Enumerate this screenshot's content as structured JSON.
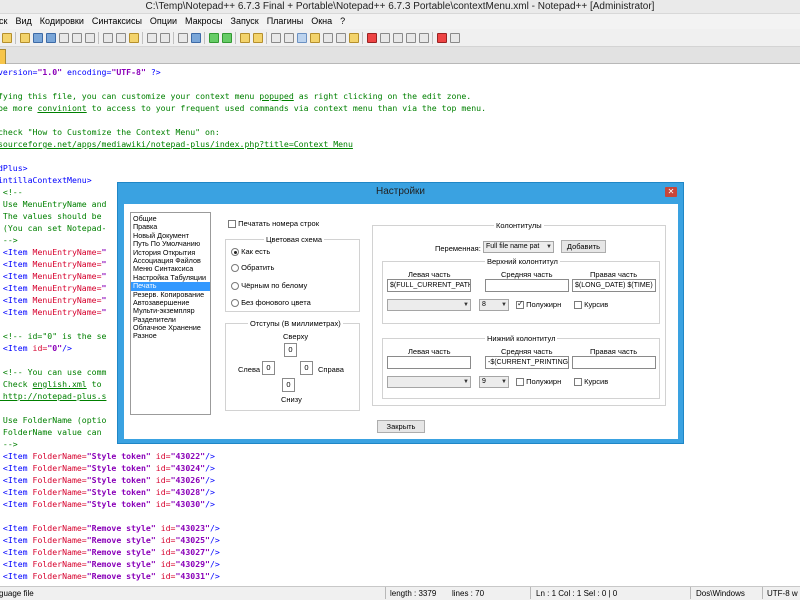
{
  "window": {
    "title": "C:\\Temp\\Notepad++ 6.7.3 Final + Portable\\Notepad++ 6.7.3 Portable\\contextMenu.xml - Notepad++ [Administrator]"
  },
  "menu": [
    "иск",
    "Вид",
    "Кодировки",
    "Синтаксисы",
    "Опции",
    "Макросы",
    "Запуск",
    "Плагины",
    "Окна",
    "?"
  ],
  "editor": {
    "lines": [
      {
        "parts": [
          {
            "c": "k",
            "t": "version="
          },
          {
            "c": "s",
            "t": "\"1.0\""
          },
          {
            "c": "k",
            "t": " encoding="
          },
          {
            "c": "s",
            "t": "\"UTF-8\""
          },
          {
            "c": "k",
            "t": " ?>"
          }
        ]
      },
      {
        "parts": []
      },
      {
        "parts": [
          {
            "c": "c",
            "t": "fying this file, you can customize your context menu "
          },
          {
            "c": "u",
            "t": "popuped"
          },
          {
            "c": "c",
            "t": " as right clicking on the edit zone."
          }
        ]
      },
      {
        "parts": [
          {
            "c": "c",
            "t": "be more "
          },
          {
            "c": "u",
            "t": "conviniont"
          },
          {
            "c": "c",
            "t": " to access to your frequent used commands via context menu than via the top menu."
          }
        ]
      },
      {
        "parts": []
      },
      {
        "parts": [
          {
            "c": "c",
            "t": "check \"How to Customize the Context Menu\" on:"
          }
        ]
      },
      {
        "parts": [
          {
            "c": "u",
            "t": "sourceforge.net/apps/mediawiki/notepad-plus/index.php?title=Context_Menu"
          }
        ]
      },
      {
        "parts": []
      },
      {
        "parts": [
          {
            "c": "t",
            "t": "dPlus>"
          }
        ]
      },
      {
        "parts": [
          {
            "c": "t",
            "t": "intillaContextMenu>"
          }
        ]
      },
      {
        "parts": [
          {
            "c": "c",
            "t": " <!--"
          }
        ]
      },
      {
        "parts": [
          {
            "c": "c",
            "t": " Use MenuEntryName and"
          }
        ]
      },
      {
        "parts": [
          {
            "c": "c",
            "t": " The values should be"
          }
        ]
      },
      {
        "parts": [
          {
            "c": "c",
            "t": " (You can set Notepad-"
          }
        ]
      },
      {
        "parts": [
          {
            "c": "c",
            "t": " -->"
          }
        ]
      },
      {
        "parts": [
          {
            "c": "t",
            "t": " <Item "
          },
          {
            "c": "a",
            "t": "MenuEntryName="
          },
          {
            "c": "s",
            "t": "\""
          }
        ]
      },
      {
        "parts": [
          {
            "c": "t",
            "t": " <Item "
          },
          {
            "c": "a",
            "t": "MenuEntryName="
          },
          {
            "c": "s",
            "t": "\""
          }
        ]
      },
      {
        "parts": [
          {
            "c": "t",
            "t": " <Item "
          },
          {
            "c": "a",
            "t": "MenuEntryName="
          },
          {
            "c": "s",
            "t": "\""
          }
        ]
      },
      {
        "parts": [
          {
            "c": "t",
            "t": " <Item "
          },
          {
            "c": "a",
            "t": "MenuEntryName="
          },
          {
            "c": "s",
            "t": "\""
          }
        ]
      },
      {
        "parts": [
          {
            "c": "t",
            "t": " <Item "
          },
          {
            "c": "a",
            "t": "MenuEntryName="
          },
          {
            "c": "s",
            "t": "\""
          }
        ]
      },
      {
        "parts": [
          {
            "c": "t",
            "t": " <Item "
          },
          {
            "c": "a",
            "t": "MenuEntryName="
          },
          {
            "c": "s",
            "t": "\""
          }
        ]
      },
      {
        "parts": []
      },
      {
        "parts": [
          {
            "c": "c",
            "t": " <!-- id=\"0\" is the se"
          }
        ]
      },
      {
        "parts": [
          {
            "c": "t",
            "t": " <Item "
          },
          {
            "c": "a",
            "t": "id="
          },
          {
            "c": "s",
            "t": "\"0\""
          },
          {
            "c": "t",
            "t": "/>"
          }
        ]
      },
      {
        "parts": []
      },
      {
        "parts": [
          {
            "c": "c",
            "t": " <!-- You can use comm"
          }
        ]
      },
      {
        "parts": [
          {
            "c": "c",
            "t": " Check "
          },
          {
            "c": "u",
            "t": "english.xml"
          },
          {
            "c": "c",
            "t": " to"
          }
        ]
      },
      {
        "parts": [
          {
            "c": "u",
            "t": " http://notepad-plus.s"
          }
        ]
      },
      {
        "parts": []
      },
      {
        "parts": [
          {
            "c": "c",
            "t": " Use FolderName (optio"
          }
        ]
      },
      {
        "parts": [
          {
            "c": "c",
            "t": " FolderName value can"
          }
        ]
      },
      {
        "parts": [
          {
            "c": "c",
            "t": " -->"
          }
        ]
      },
      {
        "parts": [
          {
            "c": "t",
            "t": " <Item "
          },
          {
            "c": "a",
            "t": "FolderName="
          },
          {
            "c": "s",
            "t": "\"Style token\""
          },
          {
            "c": "a",
            "t": " id="
          },
          {
            "c": "s",
            "t": "\"43022\""
          },
          {
            "c": "t",
            "t": "/>"
          }
        ]
      },
      {
        "parts": [
          {
            "c": "t",
            "t": " <Item "
          },
          {
            "c": "a",
            "t": "FolderName="
          },
          {
            "c": "s",
            "t": "\"Style token\""
          },
          {
            "c": "a",
            "t": " id="
          },
          {
            "c": "s",
            "t": "\"43024\""
          },
          {
            "c": "t",
            "t": "/>"
          }
        ]
      },
      {
        "parts": [
          {
            "c": "t",
            "t": " <Item "
          },
          {
            "c": "a",
            "t": "FolderName="
          },
          {
            "c": "s",
            "t": "\"Style token\""
          },
          {
            "c": "a",
            "t": " id="
          },
          {
            "c": "s",
            "t": "\"43026\""
          },
          {
            "c": "t",
            "t": "/>"
          }
        ]
      },
      {
        "parts": [
          {
            "c": "t",
            "t": " <Item "
          },
          {
            "c": "a",
            "t": "FolderName="
          },
          {
            "c": "s",
            "t": "\"Style token\""
          },
          {
            "c": "a",
            "t": " id="
          },
          {
            "c": "s",
            "t": "\"43028\""
          },
          {
            "c": "t",
            "t": "/>"
          }
        ]
      },
      {
        "parts": [
          {
            "c": "t",
            "t": " <Item "
          },
          {
            "c": "a",
            "t": "FolderName="
          },
          {
            "c": "s",
            "t": "\"Style token\""
          },
          {
            "c": "a",
            "t": " id="
          },
          {
            "c": "s",
            "t": "\"43030\""
          },
          {
            "c": "t",
            "t": "/>"
          }
        ]
      },
      {
        "parts": []
      },
      {
        "parts": [
          {
            "c": "t",
            "t": " <Item "
          },
          {
            "c": "a",
            "t": "FolderName="
          },
          {
            "c": "s",
            "t": "\"Remove style\""
          },
          {
            "c": "a",
            "t": " id="
          },
          {
            "c": "s",
            "t": "\"43023\""
          },
          {
            "c": "t",
            "t": "/>"
          }
        ]
      },
      {
        "parts": [
          {
            "c": "t",
            "t": " <Item "
          },
          {
            "c": "a",
            "t": "FolderName="
          },
          {
            "c": "s",
            "t": "\"Remove style\""
          },
          {
            "c": "a",
            "t": " id="
          },
          {
            "c": "s",
            "t": "\"43025\""
          },
          {
            "c": "t",
            "t": "/>"
          }
        ]
      },
      {
        "parts": [
          {
            "c": "t",
            "t": " <Item "
          },
          {
            "c": "a",
            "t": "FolderName="
          },
          {
            "c": "s",
            "t": "\"Remove style\""
          },
          {
            "c": "a",
            "t": " id="
          },
          {
            "c": "s",
            "t": "\"43027\""
          },
          {
            "c": "t",
            "t": "/>"
          }
        ]
      },
      {
        "parts": [
          {
            "c": "t",
            "t": " <Item "
          },
          {
            "c": "a",
            "t": "FolderName="
          },
          {
            "c": "s",
            "t": "\"Remove style\""
          },
          {
            "c": "a",
            "t": " id="
          },
          {
            "c": "s",
            "t": "\"43029\""
          },
          {
            "c": "t",
            "t": "/>"
          }
        ]
      },
      {
        "parts": [
          {
            "c": "t",
            "t": " <Item "
          },
          {
            "c": "a",
            "t": "FolderName="
          },
          {
            "c": "s",
            "t": "\"Remove style\""
          },
          {
            "c": "a",
            "t": " id="
          },
          {
            "c": "s",
            "t": "\"43031\""
          },
          {
            "c": "t",
            "t": "/>"
          }
        ]
      }
    ]
  },
  "status": {
    "lang": "guage file",
    "length": "length : 3379",
    "lines": "lines : 70",
    "pos": "Ln : 1   Col : 1   Sel : 0 | 0",
    "eol": "Dos\\Windows",
    "enc": "UTF-8 w"
  },
  "dialog": {
    "title": "Настройки",
    "close_glyph": "✕",
    "categories": [
      "Общие",
      "Правка",
      "Новый Документ",
      "Путь По Умолчанию",
      "История Открытия",
      "Ассоциация Файлов",
      "Меню Синтаксиса",
      "Настройка Табуляции",
      "Печать",
      "Резерв. Копирование",
      "Автозавершение",
      "Мульти-экземпляр",
      "Разделители",
      "Облачное Хранение",
      "Разное"
    ],
    "selected_category": 8,
    "print_line_numbers": "Печатать номера строк",
    "color_scheme": {
      "label": "Цветовая схема",
      "options": [
        "Как есть",
        "Обратить",
        "Чёрным по белому",
        "Без фонового цвета"
      ],
      "selected": 0
    },
    "margins": {
      "label": "Отступы (В миллиметрах)",
      "top_label": "Сверху",
      "top": "0",
      "left_label": "Слева",
      "left": "0",
      "right_label": "Справа",
      "right": "0",
      "bottom_label": "Снизу",
      "bottom": "0"
    },
    "headers_footers": {
      "label": "Колонтитулы",
      "variable_label": "Переменная:",
      "variable_value": "Full file name pat",
      "add_button": "Добавить",
      "header": {
        "label": "Верхний колонтитул",
        "left_label": "Левая часть",
        "left_value": "$(FULL_CURRENT_PATH)",
        "center_label": "Средняя часть",
        "center_value": "",
        "right_label": "Правая часть",
        "right_value": "$(LONG_DATE) $(TIME)",
        "font_size": "8",
        "bold_label": "Полужирн",
        "bold": true,
        "italic_label": "Курсив",
        "italic": false
      },
      "footer": {
        "label": "Нижний колонтитул",
        "left_label": "Левая часть",
        "left_value": "",
        "center_label": "Средняя часть",
        "center_value": "-$(CURRENT_PRINTING_PAGE)-",
        "right_label": "Правая часть",
        "right_value": "",
        "font_size": "9",
        "bold_label": "Полужирн",
        "bold": false,
        "italic_label": "Курсив",
        "italic": false
      }
    },
    "close_button": "Закрыть"
  }
}
